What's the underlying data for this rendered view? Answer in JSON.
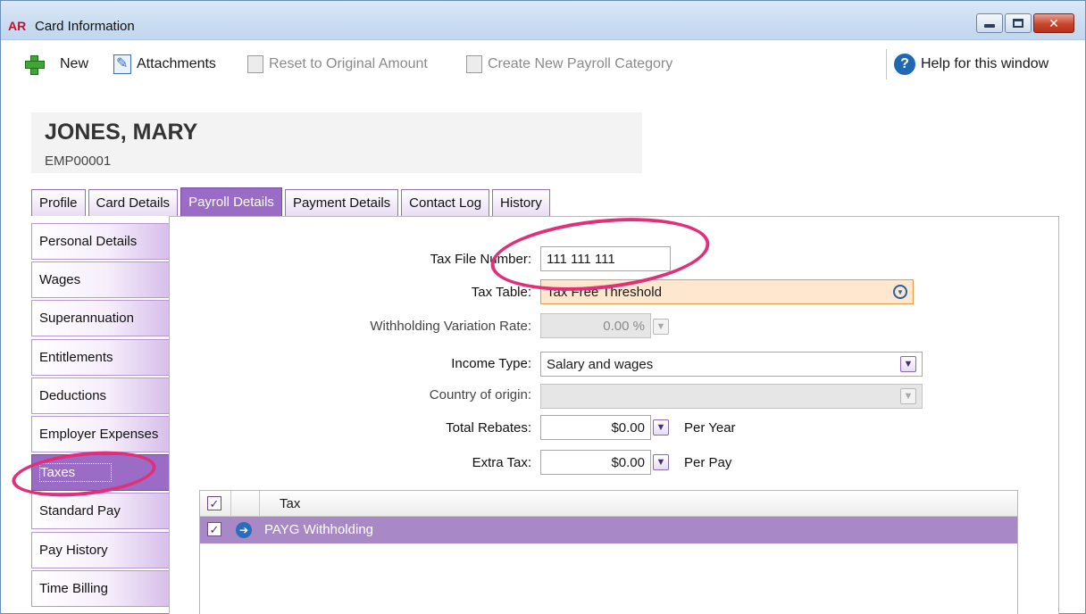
{
  "window": {
    "app_badge": "AR",
    "title": "Card Information"
  },
  "toolbar": {
    "new_label": "New",
    "attachments_label": "Attachments",
    "reset_label": "Reset to Original Amount",
    "create_category_label": "Create New Payroll Category",
    "help_label": "Help for this window"
  },
  "employee": {
    "name": "JONES, MARY",
    "id": "EMP00001"
  },
  "tabs": [
    {
      "label": "Profile",
      "active": false
    },
    {
      "label": "Card Details",
      "active": false
    },
    {
      "label": "Payroll Details",
      "active": true
    },
    {
      "label": "Payment Details",
      "active": false
    },
    {
      "label": "Contact Log",
      "active": false
    },
    {
      "label": "History",
      "active": false
    }
  ],
  "sidenav": [
    {
      "label": "Personal Details"
    },
    {
      "label": "Wages"
    },
    {
      "label": "Superannuation"
    },
    {
      "label": "Entitlements"
    },
    {
      "label": "Deductions"
    },
    {
      "label": "Employer Expenses"
    },
    {
      "label": "Taxes",
      "active": true
    },
    {
      "label": "Standard Pay"
    },
    {
      "label": "Pay History"
    },
    {
      "label": "Time Billing"
    }
  ],
  "form": {
    "tfn": {
      "label": "Tax File Number:",
      "value": "111 111 111"
    },
    "tax_table": {
      "label": "Tax Table:",
      "value": "Tax Free Threshold"
    },
    "withholding_rate": {
      "label": "Withholding Variation Rate:",
      "value": "0.00 %"
    },
    "income_type": {
      "label": "Income Type:",
      "value": "Salary and wages"
    },
    "country": {
      "label": "Country of origin:",
      "value": ""
    },
    "total_rebates": {
      "label": "Total Rebates:",
      "value": "$0.00",
      "suffix": "Per Year"
    },
    "extra_tax": {
      "label": "Extra Tax:",
      "value": "$0.00",
      "suffix": "Per Pay"
    }
  },
  "grid": {
    "header_tax": "Tax",
    "rows": [
      {
        "checked": true,
        "name": "PAYG Withholding"
      }
    ]
  },
  "colors": {
    "accent": "#9b6cc5",
    "highlight_ring": "#e0307a",
    "row_selected": "#a889c6"
  },
  "icons": [
    "plus-icon",
    "attachment-icon",
    "reset-icon",
    "create-category-icon",
    "help-icon",
    "dropdown-icon",
    "arrow-right-icon",
    "checkbox-icon"
  ]
}
